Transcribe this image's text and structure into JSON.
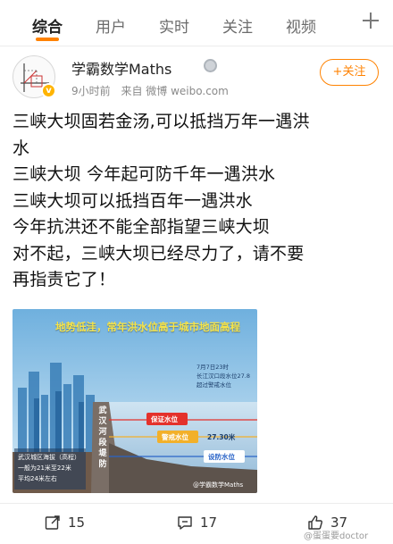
{
  "tabs": [
    "综合",
    "用户",
    "实时",
    "关注",
    "视频"
  ],
  "post": {
    "author": "学霸数学Maths",
    "time": "9小时前",
    "source": "来自 微博 weibo.com",
    "follow_label": "+关注",
    "lines": [
      "三峡大坝固若金汤,可以抵挡万年一遇洪",
      "水",
      "三峡大坝 今年起可防千年一遇洪水",
      "三峡大坝可以抵挡百年一遇洪水",
      "今年抗洪还不能全部指望三峡大坝",
      "对不起，三峡大坝已经尽力了，请不要",
      "再指责它了！"
    ]
  },
  "image": {
    "title": "地势低洼，常年洪水位高于城市地面高程",
    "date_line1": "7月7日23时",
    "date_line2": "长江汉口段水位27.8",
    "date_line3": "超过警戒水位",
    "dike_label": [
      "武",
      "汉",
      "河",
      "段",
      "堤",
      "防"
    ],
    "guarantee_level": "保证水位",
    "warning_level": "警戒水位",
    "warning_value": "27.30米",
    "defense_level": "设防水位",
    "left_line1": "武汉城区海拔（高程）",
    "left_line2": "一般为21米至22米",
    "left_line3": "平均24米左右",
    "image_watermark": "@学霸数学Maths"
  },
  "actions": {
    "repost_count": "15",
    "comment_count": "17",
    "like_count": "37"
  },
  "page_watermark": "@蛋蛋要doctor",
  "colors": {
    "accent": "#ff8200",
    "guarantee": "#e4312b",
    "warning": "#f2b02a",
    "defense": "#2a64c8"
  }
}
